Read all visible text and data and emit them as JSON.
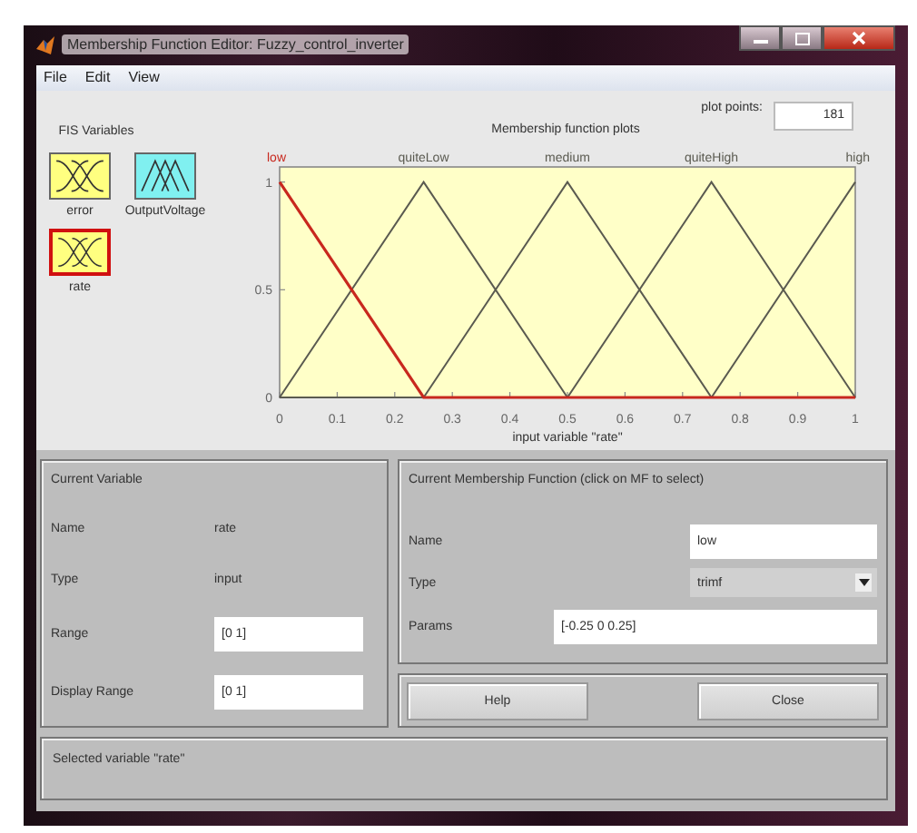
{
  "window": {
    "title": "Membership Function Editor: Fuzzy_control_inverter"
  },
  "menu": [
    "File",
    "Edit",
    "View"
  ],
  "fis_variables": {
    "title": "FIS Variables",
    "items": [
      {
        "label": "error",
        "kind": "input",
        "selected": false
      },
      {
        "label": "OutputVoltage",
        "kind": "output",
        "selected": false
      },
      {
        "label": "rate",
        "kind": "input",
        "selected": true
      }
    ]
  },
  "plot": {
    "plot_points_label": "plot points:",
    "plot_points": "181",
    "chart_data": {
      "type": "line",
      "title": "Membership function plots",
      "xlabel": "input variable \"rate\"",
      "x": [
        0,
        0.25,
        0.5,
        0.75,
        1
      ],
      "series": [
        {
          "name": "low",
          "color": "#c8281e",
          "values": [
            1,
            0,
            0,
            0,
            0
          ]
        },
        {
          "name": "quiteLow",
          "color": "#5a5a50",
          "values": [
            0,
            1,
            0,
            0,
            0
          ]
        },
        {
          "name": "medium",
          "color": "#5a5a50",
          "values": [
            0,
            0,
            1,
            0,
            0
          ]
        },
        {
          "name": "quiteHigh",
          "color": "#5a5a50",
          "values": [
            0,
            0,
            0,
            1,
            0
          ]
        },
        {
          "name": "high",
          "color": "#5a5a50",
          "values": [
            0,
            0,
            0,
            0,
            1
          ]
        }
      ],
      "xlim": [
        0,
        1
      ],
      "ylim": [
        0,
        1.07
      ],
      "xticks": [
        0,
        0.1,
        0.2,
        0.3,
        0.4,
        0.5,
        0.6,
        0.7,
        0.8,
        0.9,
        1
      ],
      "yticks": [
        0,
        0.5,
        1
      ]
    }
  },
  "current_variable": {
    "title": "Current Variable",
    "name_label": "Name",
    "name": "rate",
    "type_label": "Type",
    "type": "input",
    "range_label": "Range",
    "range": "[0 1]",
    "display_range_label": "Display Range",
    "display_range": "[0 1]"
  },
  "current_mf": {
    "title": "Current Membership Function (click on MF to select)",
    "name_label": "Name",
    "name": "low",
    "type_label": "Type",
    "type": "trimf",
    "params_label": "Params",
    "params": "[-0.25 0 0.25]"
  },
  "buttons": [
    "Help",
    "Close"
  ],
  "status": "Selected variable \"rate\""
}
